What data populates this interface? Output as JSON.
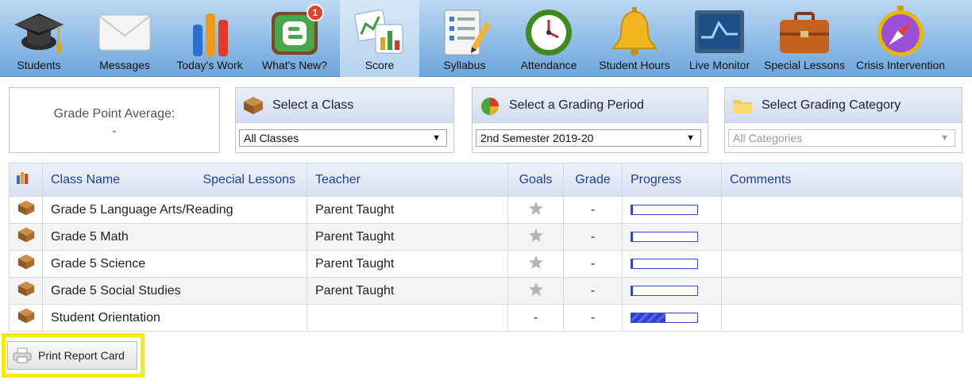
{
  "nav": {
    "items": [
      {
        "label": "Students",
        "icon": "graduation-cap-icon"
      },
      {
        "label": "Messages",
        "icon": "envelope-icon"
      },
      {
        "label": "Today's Work",
        "icon": "bar-chart-icon"
      },
      {
        "label": "What's New?",
        "icon": "blogger-icon",
        "badge": "1"
      },
      {
        "label": "Score",
        "icon": "score-charts-icon"
      },
      {
        "label": "Syllabus",
        "icon": "syllabus-list-icon"
      },
      {
        "label": "Attendance",
        "icon": "clock-icon"
      },
      {
        "label": "Student Hours",
        "icon": "bell-icon"
      },
      {
        "label": "Live Monitor",
        "icon": "monitor-icon"
      },
      {
        "label": "Special Lessons",
        "icon": "briefcase-icon"
      },
      {
        "label": "Crisis Intervention",
        "icon": "compass-icon"
      }
    ],
    "active": "Score"
  },
  "gpa": {
    "label": "Grade Point Average:",
    "value": "-"
  },
  "class_panel": {
    "title": "Select a Class",
    "selected": "All Classes"
  },
  "period_panel": {
    "title": "Select a Grading Period",
    "selected": "2nd Semester 2019-20"
  },
  "category_panel": {
    "title": "Select Grading Category",
    "selected": "All Categories"
  },
  "table": {
    "headers": {
      "class_name": "Class Name",
      "special_lessons": "Special Lessons",
      "teacher": "Teacher",
      "goals": "Goals",
      "grade": "Grade",
      "progress": "Progress",
      "comments": "Comments"
    },
    "rows": [
      {
        "name": "Grade 5 Language Arts/Reading",
        "teacher": "Parent Taught",
        "goal": "star",
        "grade": "-",
        "progress": 0.02,
        "comment": ""
      },
      {
        "name": "Grade 5 Math",
        "teacher": "Parent Taught",
        "goal": "star",
        "grade": "-",
        "progress": 0.02,
        "comment": ""
      },
      {
        "name": "Grade 5 Science",
        "teacher": "Parent Taught",
        "goal": "star",
        "grade": "-",
        "progress": 0.02,
        "comment": ""
      },
      {
        "name": "Grade 5 Social Studies",
        "teacher": "Parent Taught",
        "goal": "star",
        "grade": "-",
        "progress": 0.02,
        "comment": ""
      },
      {
        "name": "Student Orientation",
        "teacher": "",
        "goal": "-",
        "grade": "-",
        "progress": 0.52,
        "comment": ""
      }
    ]
  },
  "print_button": {
    "label": "Print Report Card"
  },
  "colors": {
    "highlight": "#f5ec0b",
    "progress": "#2f3fd0",
    "header_text": "#1f3f8f"
  }
}
